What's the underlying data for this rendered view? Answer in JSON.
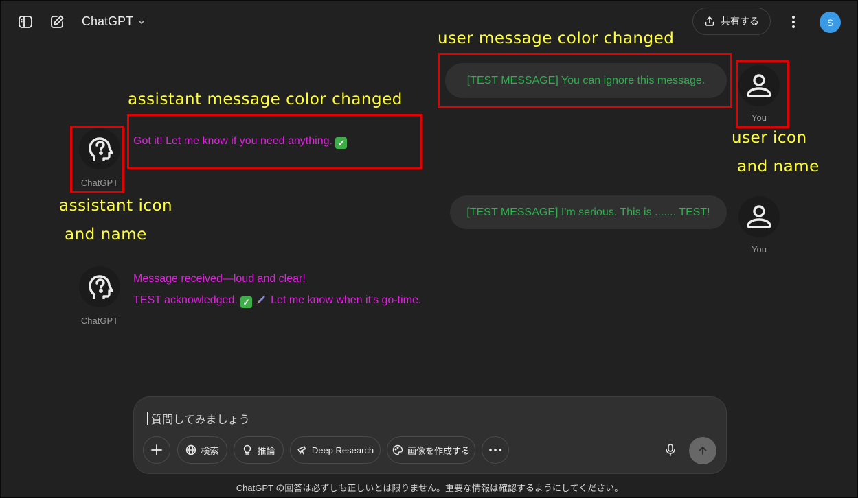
{
  "header": {
    "title": "ChatGPT",
    "share_label": "共有する",
    "avatar_letter": "S"
  },
  "annotations": {
    "user_msg_color": "user message color changed",
    "assistant_msg_color": "assistant message color changed",
    "user_icon_line1": "user icon",
    "user_icon_line2": "and name",
    "assistant_icon_line1": "assistant icon",
    "assistant_icon_line2": "and name"
  },
  "messages": [
    {
      "role": "user",
      "name": "You",
      "text": "[TEST MESSAGE] You can ignore this message."
    },
    {
      "role": "assistant",
      "name": "ChatGPT",
      "text": "Got it! Let me know if you need anything."
    },
    {
      "role": "user",
      "name": "You",
      "text": "[TEST MESSAGE] I'm serious. This is ....... TEST!"
    },
    {
      "role": "assistant",
      "name": "ChatGPT",
      "line1": "Message received—loud and clear!",
      "line2a": "TEST acknowledged.",
      "line2b": "Let me know when it's go-time."
    }
  ],
  "composer": {
    "placeholder": "質問してみましょう",
    "tools": {
      "search": "検索",
      "reason": "推論",
      "deep_research": "Deep Research",
      "create_image": "画像を作成する"
    }
  },
  "footer": "ChatGPT の回答は必ずしも正しいとは限りません。重要な情報は確認するようにしてください。",
  "colors": {
    "background": "#212121",
    "user_text": "#2bb24c",
    "assistant_text": "#e021e0",
    "annotation": "#ffff33",
    "highlight_box": "#e30000",
    "avatar": "#3b9ae6"
  }
}
